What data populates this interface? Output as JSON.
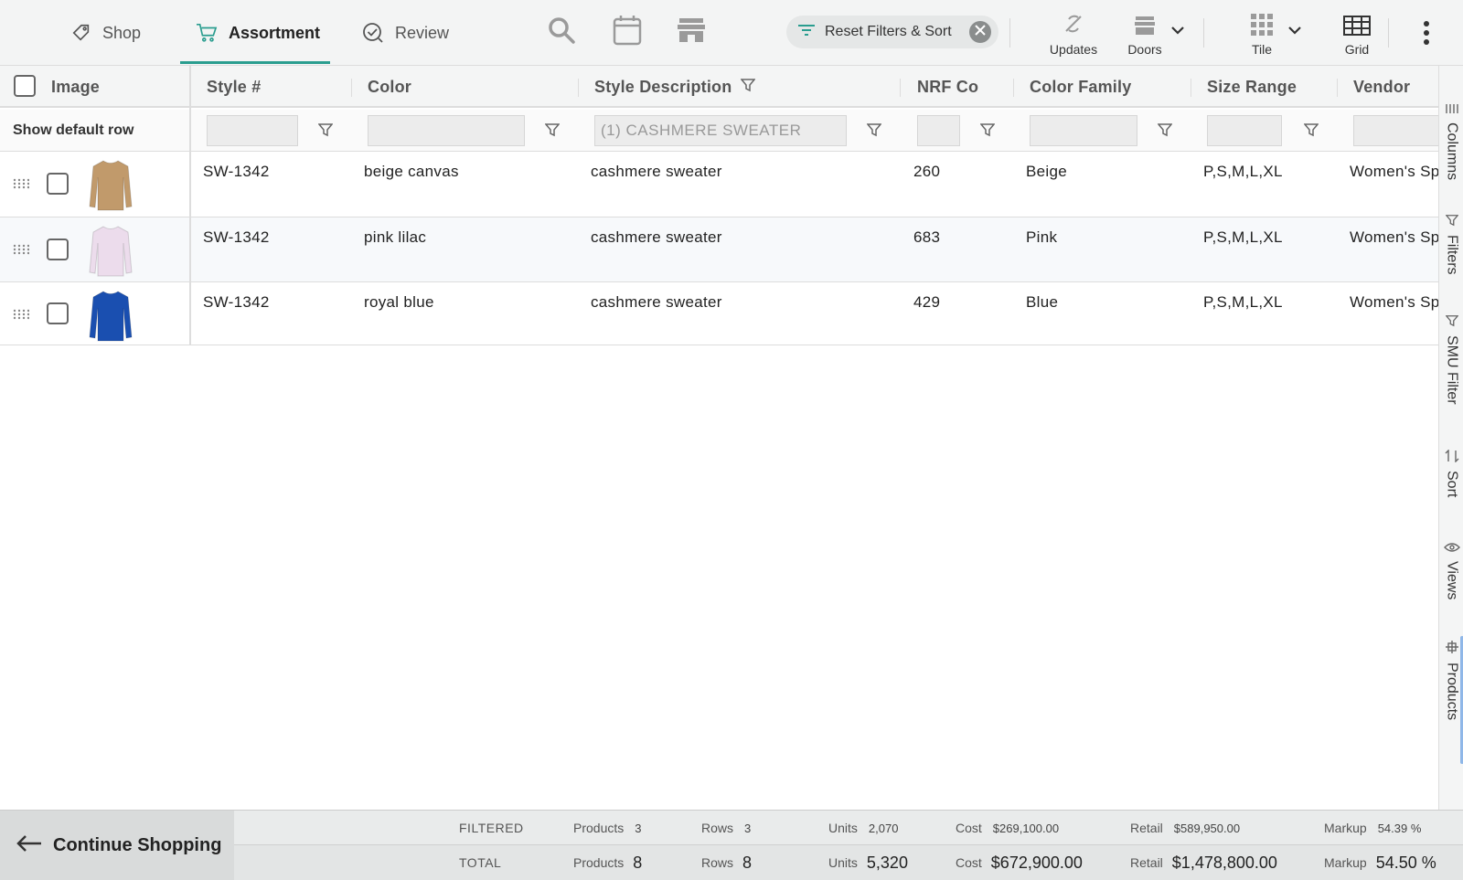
{
  "topbar": {
    "tabs": [
      {
        "label": "Shop"
      },
      {
        "label": "Assortment"
      },
      {
        "label": "Review"
      }
    ],
    "reset_label": "Reset Filters & Sort",
    "tools": {
      "updates": "Updates",
      "doors": "Doors",
      "tile": "Tile",
      "grid": "Grid"
    }
  },
  "grid": {
    "columns": {
      "image": "Image",
      "style": "Style #",
      "color": "Color",
      "desc": "Style Description",
      "nrf": "NRF Co",
      "family": "Color Family",
      "size": "Size Range",
      "vendor": "Vendor"
    },
    "show_default_row": "Show default row",
    "desc_filter_value": "(1) CASHMERE SWEATER",
    "rows": [
      {
        "style": "SW-1342",
        "color": "beige canvas",
        "desc": "cashmere sweater",
        "nrf": "260",
        "family": "Beige",
        "size": "P,S,M,L,XL",
        "vendor": "Women's Sp",
        "swatch": "#c19a6b"
      },
      {
        "style": "SW-1342",
        "color": "pink lilac",
        "desc": "cashmere sweater",
        "nrf": "683",
        "family": "Pink",
        "size": "P,S,M,L,XL",
        "vendor": "Women's Sp",
        "swatch": "#ecdcec"
      },
      {
        "style": "SW-1342",
        "color": "royal blue",
        "desc": "cashmere sweater",
        "nrf": "429",
        "family": "Blue",
        "size": "P,S,M,L,XL",
        "vendor": "Women's Sp",
        "swatch": "#1a4fb0"
      }
    ]
  },
  "sidepanel": {
    "columns": "Columns",
    "filters": "Filters",
    "smu": "SMU Filter",
    "sort": "Sort",
    "views": "Views",
    "products": "Products"
  },
  "footer": {
    "continue": "Continue Shopping",
    "filtered": {
      "label": "FILTERED",
      "products_label": "Products",
      "products": "3",
      "rows_label": "Rows",
      "rows": "3",
      "units_label": "Units",
      "units": "2,070",
      "cost_label": "Cost",
      "cost": "$269,100.00",
      "retail_label": "Retail",
      "retail": "$589,950.00",
      "markup_label": "Markup",
      "markup": "54.39 %"
    },
    "total": {
      "label": "TOTAL",
      "products_label": "Products",
      "products": "8",
      "rows_label": "Rows",
      "rows": "8",
      "units_label": "Units",
      "units": "5,320",
      "cost_label": "Cost",
      "cost": "$672,900.00",
      "retail_label": "Retail",
      "retail": "$1,478,800.00",
      "markup_label": "Markup",
      "markup": "54.50 %"
    }
  }
}
